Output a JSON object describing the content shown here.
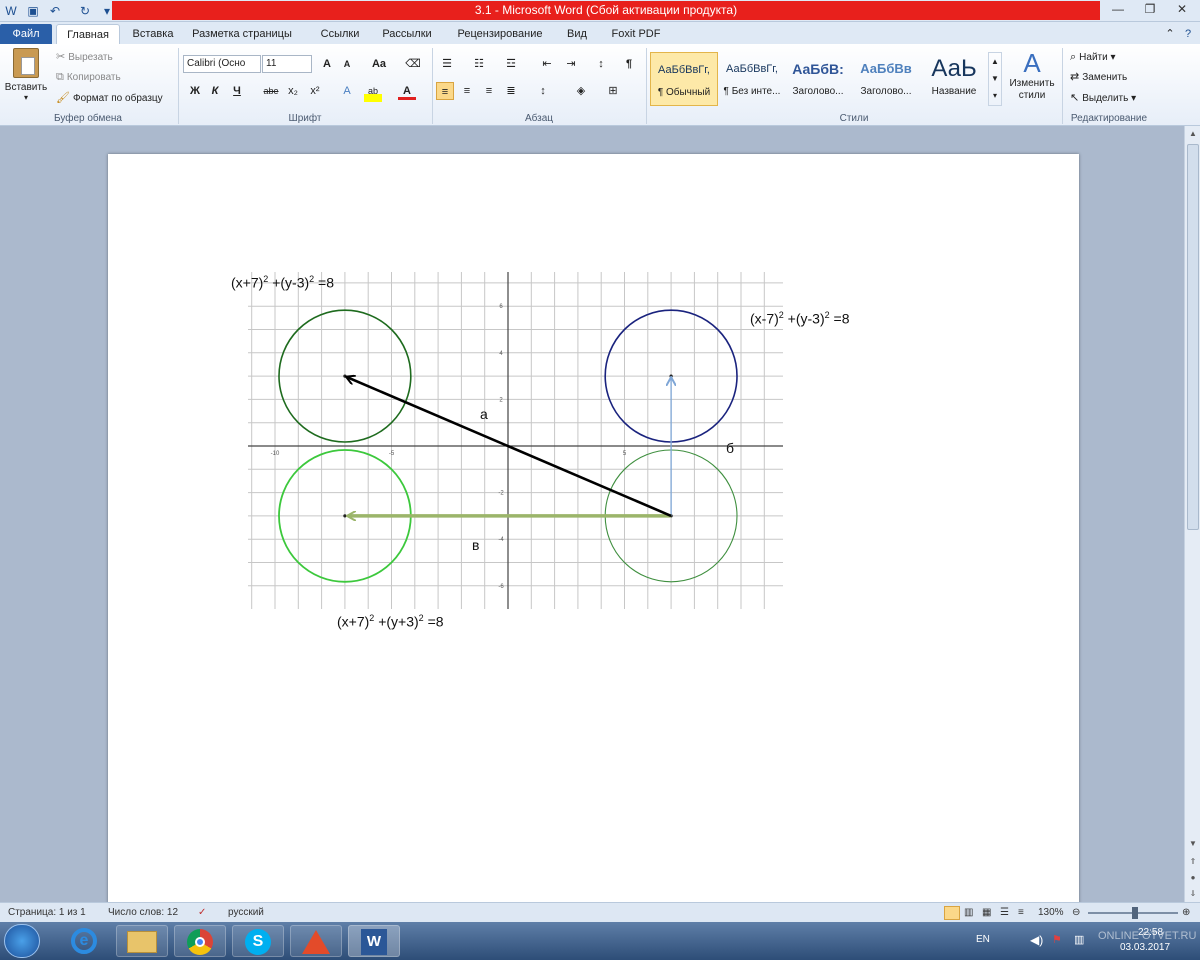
{
  "window": {
    "title": "3.1 - Microsoft Word (Сбой активации продукта)",
    "minimize": "—",
    "maximize": "❐",
    "close": "✕"
  },
  "ribbon_tabs": [
    "Файл",
    "Главная",
    "Вставка",
    "Разметка страницы",
    "Ссылки",
    "Рассылки",
    "Рецензирование",
    "Вид",
    "Foxit PDF"
  ],
  "clipboard": {
    "paste": "Вставить",
    "cut": "Вырезать",
    "copy": "Копировать",
    "format_painter": "Формат по образцу",
    "group_label": "Буфер обмена"
  },
  "font": {
    "name": "Calibri (Осно",
    "size": "11",
    "group_label": "Шрифт",
    "bold": "Ж",
    "italic": "К",
    "underline": "Ч",
    "strike": "abe",
    "subscript": "x₂",
    "superscript": "x²",
    "grow": "A",
    "shrink": "A",
    "case": "Aa"
  },
  "paragraph": {
    "group_label": "Абзац",
    "pilcrow": "¶"
  },
  "styles": {
    "group_label": "Стили",
    "items": [
      {
        "sample": "АаБбВвГг,",
        "name": "¶ Обычный"
      },
      {
        "sample": "АаБбВвГг,",
        "name": "¶ Без инте..."
      },
      {
        "sample": "АаБбВ:",
        "name": "Заголово..."
      },
      {
        "sample": "АаБбВв",
        "name": "Заголово..."
      },
      {
        "sample": "АаЬ",
        "name": "Название"
      }
    ],
    "change_styles": "Изменить стили"
  },
  "editing": {
    "group_label": "Редактирование",
    "find": "Найти",
    "replace": "Заменить",
    "select": "Выделить"
  },
  "document": {
    "eq_top_left": {
      "base": "(x+7)",
      "p1": "2",
      "mid": " +(y-3)",
      "p2": "2",
      "end": " =8"
    },
    "eq_top_right": {
      "base": "(x-7)",
      "p1": "2",
      "mid": " +(y-3)",
      "p2": "2",
      "end": " =8"
    },
    "eq_bottom": {
      "base": "(x+7)",
      "p1": "2",
      "mid": " +(y+3)",
      "p2": "2",
      "end": " =8"
    },
    "label_a": "а",
    "label_b": "б",
    "label_v": "в",
    "axis_ticks_x": [
      "-10",
      "-5",
      "5"
    ],
    "axis_ticks_y": [
      "6",
      "4",
      "2",
      "-2",
      "-4",
      "-6"
    ]
  },
  "status": {
    "page": "Страница: 1 из 1",
    "words": "Число слов: 12",
    "language": "русский",
    "zoom": "130%"
  },
  "taskbar": {
    "lang": "EN",
    "time": "22:58",
    "date": "03.03.2017",
    "watermark": "ONLINE OTVET.RU"
  },
  "colors": {
    "title_bar_alert": "#e8201c",
    "circle_top_left": "#1e6b1e",
    "circle_top_right": "#1a237e",
    "circle_bottom_left": "#3cc83c",
    "circle_bottom_right": "#3f8f3f",
    "vector_a": "#000000",
    "vector_b": "#7fa6d6",
    "vector_v": "#9bb56a"
  }
}
